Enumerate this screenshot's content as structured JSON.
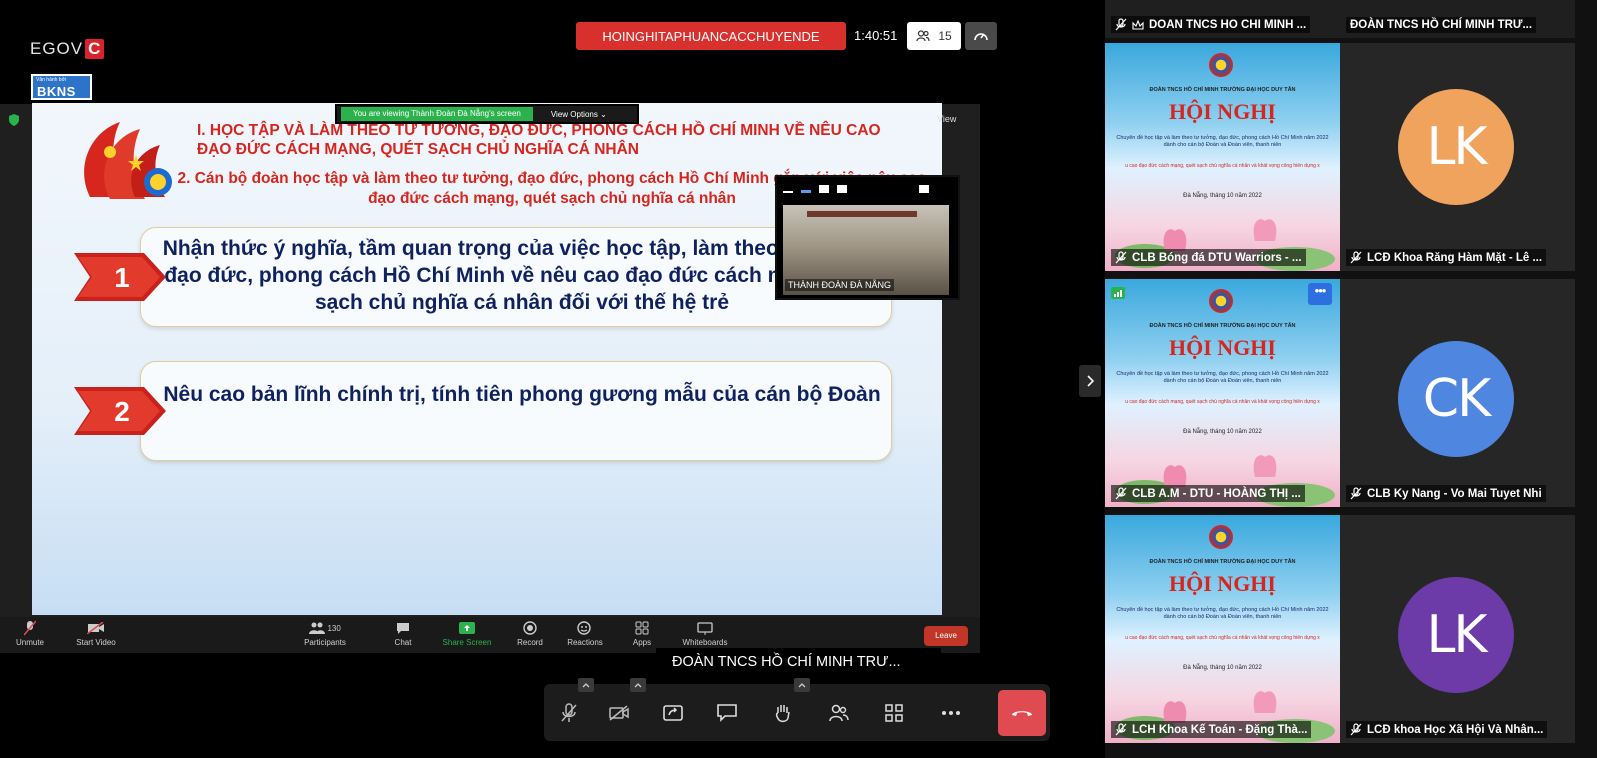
{
  "brand": {
    "egov_text": "EGOV",
    "egov_badge": "C",
    "bkns_small": "Văn hành bởi",
    "bkns_big": "BKNS"
  },
  "meeting": {
    "title": "HOINGHITAPHUANCACCHUYENDE",
    "timer": "1:40:51",
    "participant_count": "15"
  },
  "share": {
    "viewing_text": "You are viewing Thành Đoàn Đà Nẵng's screen",
    "view_options": "View Options ⌄",
    "view_label": "View"
  },
  "slide": {
    "heading1": "I. HỌC TẬP VÀ LÀM THEO TƯ TƯỞNG, ĐẠO ĐỨC, PHONG CÁCH HỒ CHÍ MINH VỀ NÊU CAO ĐẠO ĐỨC CÁCH MẠNG, QUÉT SẠCH CHỦ NGHĨA CÁ NHÂN",
    "heading2": "2. Cán bộ đoàn học tập và làm theo tư tưởng, đạo đức, phong cách Hồ Chí Minh gắn với việc nêu cao đạo đức cách mạng, quét sạch chủ nghĩa cá nhân",
    "items": [
      {
        "num": "1",
        "text": "Nhận thức ý nghĩa, tầm quan trọng của việc học tập, làm theo tư tưởng, đạo đức, phong cách Hồ Chí Minh về nêu cao đạo đức cách mạng, quét sạch chủ nghĩa cá nhân đối với thế hệ trẻ"
      },
      {
        "num": "2",
        "text": "Nêu cao bản lĩnh chính trị, tính tiên phong gương mẫu của cán bộ Đoàn"
      }
    ]
  },
  "float_video": {
    "label": "THÀNH ĐOÀN ĐÀ NẴNG"
  },
  "zoom_toolbar": {
    "unmute": "Unmute",
    "start_video": "Start Video",
    "participants": "Participants",
    "participants_count": "130",
    "chat": "Chat",
    "share_screen": "Share Screen",
    "record": "Record",
    "reactions": "Reactions",
    "apps": "Apps",
    "whiteboards": "Whiteboards",
    "leave": "Leave"
  },
  "speaker_name": "ĐOÀN TNCS HỒ CHÍ MINH TRƯ...",
  "gallery": {
    "top_left": "DOAN TNCS HO CHI MINH ...",
    "top_right": "ĐOÀN TNCS HỒ CHÍ MINH TRƯ...",
    "tiles": [
      {
        "name": "CLB Bóng đá DTU Warriors - ...",
        "kind": "poster"
      },
      {
        "name": "LCĐ Khoa Răng Hàm Mặt - Lê ...",
        "kind": "avatar",
        "initials": "LK",
        "color": "#f0a35c"
      },
      {
        "name": "CLB A.M - DTU - HOÀNG THỊ ...",
        "kind": "poster"
      },
      {
        "name": "CLB Ky Nang - Vo Mai Tuyet Nhi",
        "kind": "avatar",
        "initials": "CK",
        "color": "#4f86e0"
      },
      {
        "name": "LCH Khoa Kế Toán - Đặng Thà...",
        "kind": "poster"
      },
      {
        "name": "LCĐ khoa Học Xã Hội Và Nhân...",
        "kind": "avatar",
        "initials": "LK",
        "color": "#6c3ba8"
      }
    ],
    "poster": {
      "univ": "ĐOÀN TNCS HỒ CHÍ MINH TRƯỜNG ĐẠI HỌC DUY TÂN",
      "title": "HỘI NGHỊ",
      "sub": "Chuyên đề học tập và làm theo tư tưởng, đạo đức, phong cách Hồ Chí Minh năm 2022 dành cho cán bộ Đoàn và Đoàn viên, thanh niên",
      "red": "u cao đạo đức cách mạng, quét sạch chủ nghĩa cá nhân và khát vọng cống hiến dựng x",
      "date": "Đà Nẵng, tháng 10 năm 2022"
    }
  }
}
